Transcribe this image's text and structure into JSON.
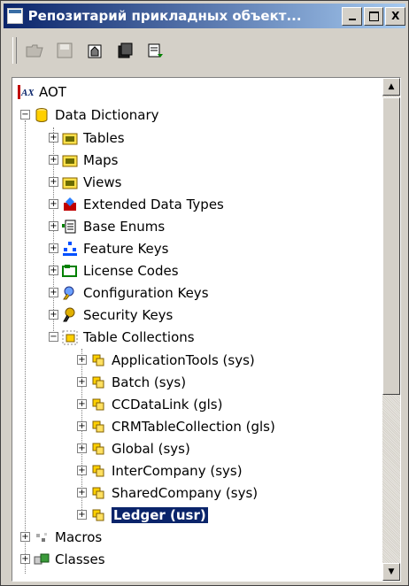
{
  "window": {
    "title": "Репозитарий прикладных объект...",
    "buttons": {
      "minimize": "",
      "maximize": "",
      "close": "X"
    }
  },
  "toolbar": {
    "items": [
      {
        "name": "open-icon"
      },
      {
        "name": "save-icon"
      },
      {
        "name": "properties-icon"
      },
      {
        "name": "compile-icon"
      },
      {
        "name": "export-icon"
      }
    ]
  },
  "tree": {
    "root": "AOT",
    "data_dictionary": "Data Dictionary",
    "dd_children": [
      "Tables",
      "Maps",
      "Views",
      "Extended Data Types",
      "Base Enums",
      "Feature Keys",
      "License Codes",
      "Configuration Keys",
      "Security Keys",
      "Table Collections"
    ],
    "collections": [
      "ApplicationTools (sys)",
      "Batch (sys)",
      "CCDataLink (gls)",
      "CRMTableCollection (gls)",
      "Global (sys)",
      "InterCompany (sys)",
      "SharedCompany (sys)",
      "Ledger (usr)"
    ],
    "after": [
      "Macros",
      "Classes"
    ]
  }
}
